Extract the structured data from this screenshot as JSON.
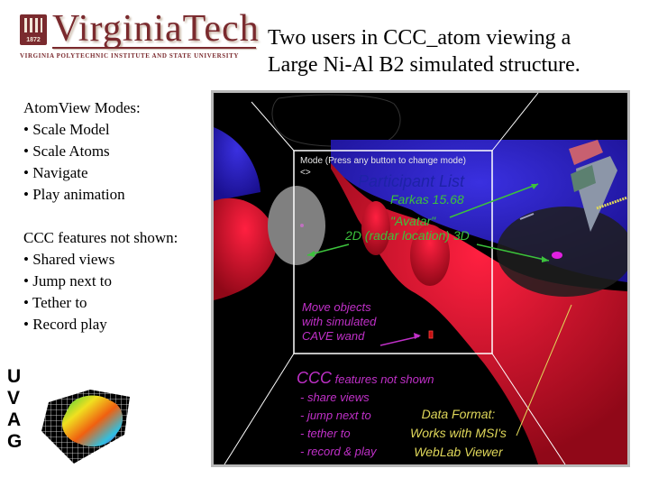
{
  "logo": {
    "wordmark": "VirginiaTech",
    "year": "1872",
    "subtitle": "VIRGINIA POLYTECHNIC INSTITUTE AND STATE UNIVERSITY"
  },
  "title": {
    "line1": "Two users in CCC_atom viewing a",
    "line2": "Large Ni-Al B2 simulated structure."
  },
  "sidebar": {
    "modes_heading": "AtomView Modes:",
    "modes": [
      "• Scale Model",
      "• Scale Atoms",
      "• Navigate",
      "• Play animation"
    ],
    "features_heading": "CCC features not shown:",
    "features": [
      "• Shared views",
      "• Jump next to",
      "• Tether to",
      "• Record play"
    ]
  },
  "uvag_logo": {
    "letters": [
      "U",
      "V",
      "A",
      "G"
    ]
  },
  "scene": {
    "mode_line1": "Mode (Press any button to change mode)",
    "mode_line2": "<>",
    "participant_list": "Participant List",
    "participant": "Farkas 15.68",
    "avatar_label": "\"Avatar\"",
    "radar_label": "2D (radar location) 3D",
    "move_label": [
      "Move objects",
      "with simulated",
      "CAVE wand"
    ],
    "ccc_heading_big": "CCC",
    "ccc_heading_rest": " features not shown",
    "ccc_items": [
      "- share views",
      "- jump next to",
      "- tether to",
      "- record & play"
    ],
    "data_format": [
      "Data Format:",
      "Works with MSI's",
      "WebLab Viewer"
    ],
    "colors": {
      "participant_list": "#1e22a8",
      "annotation_green": "#3cc23c",
      "annotation_magenta": "#c030c8",
      "annotation_yellow": "#e0d85a",
      "atom_blue": "#2a1fc8",
      "atom_red": "#d8102c"
    }
  }
}
